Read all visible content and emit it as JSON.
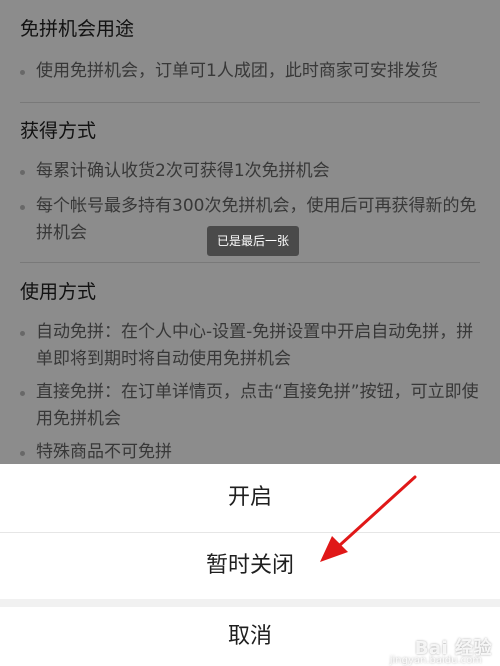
{
  "sections": [
    {
      "title": "免拼机会用途",
      "items": [
        "使用免拼机会，订单可1人成团，此时商家可安排发货"
      ]
    },
    {
      "title": "获得方式",
      "items": [
        "每累计确认收货2次可获得1次免拼机会",
        "每个帐号最多持有300次免拼机会，使用后可再获得新的免拼机会"
      ]
    },
    {
      "title": "使用方式",
      "items": [
        "自动免拼：在个人中心-设置-免拼设置中开启自动免拼，拼单即将到期时将自动使用免拼机会",
        "直接免拼：在订单详情页，点击“直接免拼”按钮，可立即使用免拼机会",
        "特殊商品不可免拼"
      ]
    }
  ],
  "toast": "已是最后一张",
  "action_sheet": {
    "enable_label": "开启",
    "disable_label": "暂时关闭",
    "cancel_label": "取消"
  },
  "watermark": {
    "text": "Bai 经验",
    "subtext": "jingyan.baidu.com"
  },
  "colors": {
    "overlay": "rgba(0,0,0,0.45)",
    "arrow": "#e01818",
    "toast_bg": "#4a4a4a"
  }
}
